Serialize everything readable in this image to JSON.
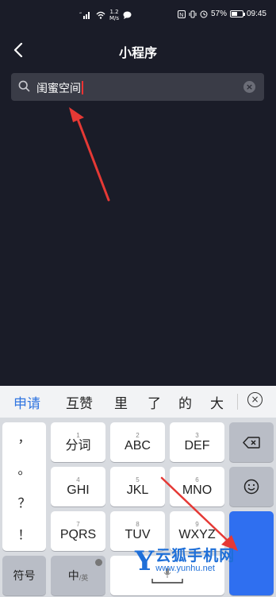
{
  "status_bar": {
    "speed_value": "1.2",
    "speed_unit": "M/s",
    "battery": "57%",
    "battery_level": 0.57,
    "time": "09:45"
  },
  "header": {
    "title": "小程序"
  },
  "search": {
    "value": "闺蜜空间"
  },
  "keyboard": {
    "candidates": [
      "申请",
      "互赞",
      "里",
      "了",
      "的",
      "大"
    ],
    "punctuation": [
      "，",
      "。",
      "？",
      "！"
    ],
    "keys": [
      {
        "num": "1",
        "label": "分词"
      },
      {
        "num": "2",
        "label": "ABC"
      },
      {
        "num": "3",
        "label": "DEF"
      },
      {
        "num": "4",
        "label": "GHI"
      },
      {
        "num": "5",
        "label": "JKL"
      },
      {
        "num": "6",
        "label": "MNO"
      },
      {
        "num": "7",
        "label": "PQRS"
      },
      {
        "num": "8",
        "label": "TUV"
      },
      {
        "num": "9",
        "label": "WXYZ"
      }
    ],
    "symbols_label": "符号",
    "lang_label": "中",
    "lang_sub": "/英"
  },
  "watermark": {
    "letter": "Y",
    "name": "云狐手机网",
    "url": "www.yunhu.net"
  },
  "colors": {
    "background": "#1a1c28",
    "search_bg": "#3a3c47",
    "accent": "#2f74e0",
    "arrow": "#e53935"
  },
  "icons": [
    "back-arrow-icon",
    "search-icon",
    "clear-icon",
    "collapse-keyboard-icon",
    "backspace-icon",
    "emoji-icon",
    "microphone-icon",
    "space-icon"
  ]
}
